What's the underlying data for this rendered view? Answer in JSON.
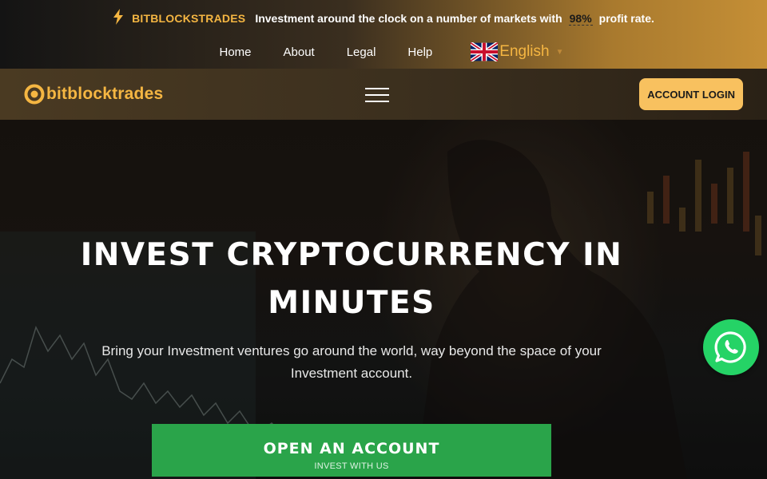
{
  "topbar": {
    "brand": "BITBLOCKSTRADES",
    "promo_before": "Investment around the clock on a number of markets with",
    "promo_rate": "98%",
    "promo_after": "profit rate."
  },
  "topnav": {
    "items": [
      {
        "label": "Home"
      },
      {
        "label": "About"
      },
      {
        "label": "Legal"
      },
      {
        "label": "Help"
      }
    ],
    "language": "English"
  },
  "header": {
    "logo_text": "bitblocktrades",
    "login_label": "ACCOUNT LOGIN"
  },
  "hero": {
    "title": "INVEST CRYPTOCURRENCY IN MINUTES",
    "subtitle": "Bring your Investment ventures go around the world, way beyond the space of your Investment account.",
    "cta_main": "OPEN AN ACCOUNT",
    "cta_sub": "INVEST WITH US"
  },
  "colors": {
    "accent": "#f5b642",
    "login_bg": "#f8c15f",
    "cta_bg": "#2aa44a",
    "whatsapp": "#25d366"
  },
  "icons": [
    "lightning-icon",
    "uk-flag-icon",
    "caret-down-icon",
    "logo-mark-icon",
    "hamburger-menu-icon",
    "whatsapp-icon"
  ]
}
